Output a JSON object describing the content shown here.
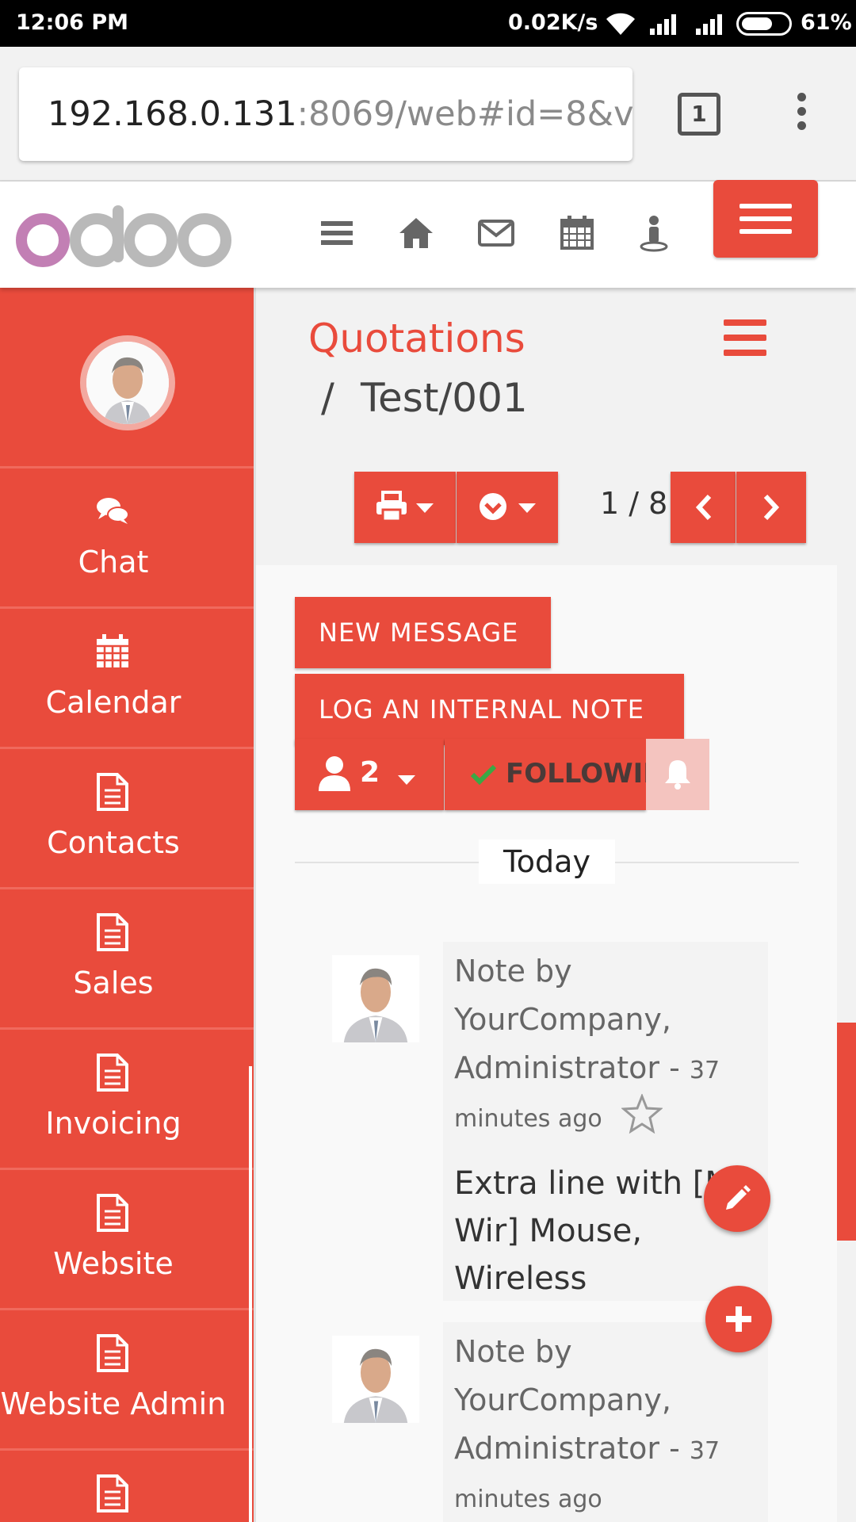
{
  "status_bar": {
    "time": "12:06 PM",
    "network_speed": "0.02K/s",
    "battery": "61%"
  },
  "browser": {
    "url_host": "192.168.0.131",
    "url_rest": ":8069/web#id=8&v",
    "tab_count": "1"
  },
  "header": {
    "icons": [
      "hamburger-icon",
      "home-icon",
      "envelope-icon",
      "calendar-icon",
      "user-icon"
    ]
  },
  "sidebar": {
    "items": [
      {
        "label": "Chat",
        "icon": "chat-icon"
      },
      {
        "label": "Calendar",
        "icon": "calendar-icon"
      },
      {
        "label": "Contacts",
        "icon": "document-icon"
      },
      {
        "label": "Sales",
        "icon": "document-icon"
      },
      {
        "label": "Invoicing",
        "icon": "document-icon"
      },
      {
        "label": "Website",
        "icon": "document-icon"
      },
      {
        "label": "Website Admin",
        "icon": "document-icon"
      }
    ]
  },
  "breadcrumb": {
    "parent": "Quotations",
    "separator": "/",
    "current": "Test/001"
  },
  "pager": {
    "value": "1 / 8"
  },
  "chatter": {
    "new_message": "NEW MESSAGE",
    "log_note": "LOG AN INTERNAL NOTE",
    "follower_count": "2",
    "following": "FOLLOWIN",
    "date_separator": "Today",
    "messages": [
      {
        "line1": "Note by",
        "line2": "YourCompany,",
        "author_tail": "Administrator - ",
        "time_num": "37",
        "time_text": "minutes ago",
        "body1": "Extra line with [M",
        "body2": "Wir] Mouse,",
        "body3": "Wireless"
      },
      {
        "line1": "Note by",
        "line2": "YourCompany,",
        "author_tail": "Administrator - ",
        "time_num": "37",
        "time_text": "minutes ago"
      }
    ]
  },
  "colors": {
    "accent": "#e94b3c",
    "status_bar": "#000000",
    "following_check": "#3aa845"
  }
}
